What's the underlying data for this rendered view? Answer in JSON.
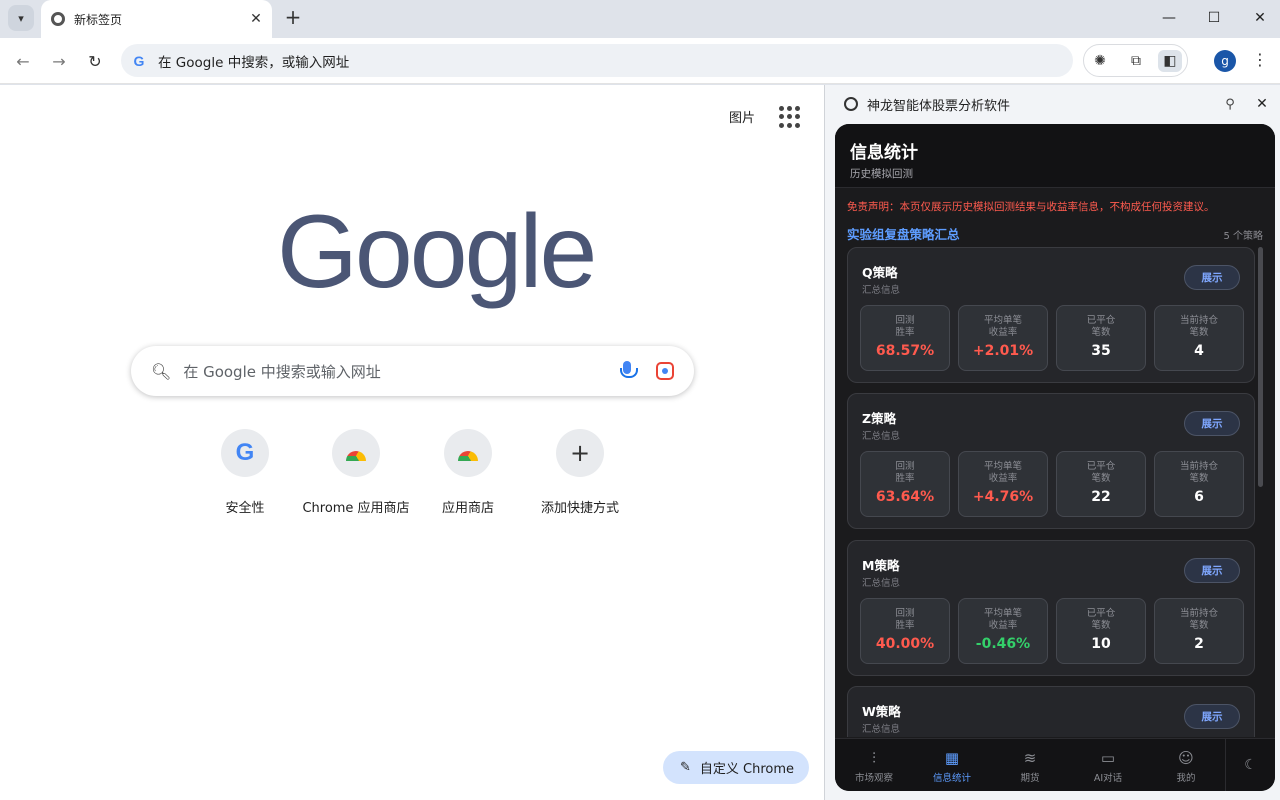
{
  "browser": {
    "tab_title": "新标签页",
    "omnibox_text": "在 Google 中搜索，或输入网址",
    "profile_initial": "g"
  },
  "ntp": {
    "images_link": "图片",
    "logo_text": "Google",
    "search_placeholder": "在 Google 中搜索或输入网址",
    "shortcuts": [
      {
        "label": "安全性",
        "icon": "google-g-icon"
      },
      {
        "label": "Chrome 应用商店",
        "icon": "chrome-webstore-icon"
      },
      {
        "label": "应用商店",
        "icon": "chrome-webstore-icon"
      },
      {
        "label": "添加快捷方式",
        "icon": "plus-icon"
      }
    ],
    "customize_label": "自定义 Chrome"
  },
  "side_panel": {
    "title": "神龙智能体股票分析软件",
    "app": {
      "header_title": "信息统计",
      "header_subtitle": "历史模拟回测",
      "disclaimer": "免责声明：本页仅展示历史模拟回测结果与收益率信息，不构成任何投资建议。",
      "section_title": "实验组复盘策略汇总",
      "section_count": "5 个策略",
      "show_label": "展示",
      "summary_label": "汇总信息",
      "stat_labels": [
        "回测\n胜率",
        "平均单笔\n收益率",
        "已平仓\n笔数",
        "当前持仓\n笔数"
      ],
      "strategies": [
        {
          "name": "Q策略",
          "win_rate": "68.57%",
          "avg_return": "+2.01%",
          "closed": "35",
          "holding": "4"
        },
        {
          "name": "Z策略",
          "win_rate": "63.64%",
          "avg_return": "+4.76%",
          "closed": "22",
          "holding": "6"
        },
        {
          "name": "M策略",
          "win_rate": "40.00%",
          "avg_return": "-0.46%",
          "closed": "10",
          "holding": "2"
        },
        {
          "name": "W策略",
          "win_rate": "",
          "avg_return": "",
          "closed": "",
          "holding": ""
        }
      ],
      "nav": [
        {
          "label": "市场观察",
          "icon": "candlestick-icon"
        },
        {
          "label": "信息统计",
          "icon": "grid-icon"
        },
        {
          "label": "期货",
          "icon": "layers-icon"
        },
        {
          "label": "AI对话",
          "icon": "chat-icon"
        },
        {
          "label": "我的",
          "icon": "user-icon"
        }
      ],
      "theme_icon": "moon-icon"
    }
  },
  "colors": {
    "accent_blue": "#5e9dff",
    "positive": "#ff5a4e",
    "negative": "#34d06a",
    "disclaimer": "#ff5b4f"
  }
}
